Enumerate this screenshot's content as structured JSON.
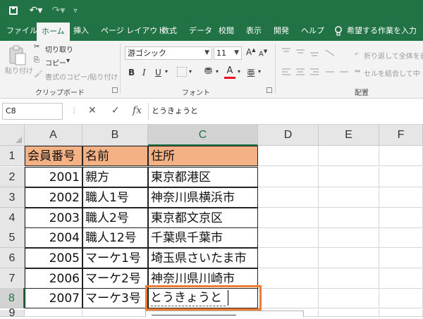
{
  "qat": {
    "customize_glyph": "▿"
  },
  "tabs": [
    "ファイル",
    "ホーム",
    "挿入",
    "ページ レイアウト",
    "数式",
    "データ",
    "校閲",
    "表示",
    "開発",
    "ヘルプ"
  ],
  "tell_me": "希望する作業を入力",
  "ribbon": {
    "clipboard": {
      "paste": "貼り付け",
      "cut": "切り取り",
      "copy": "コピー",
      "copy_caret": "▾",
      "format_painter": "書式のコピー/貼り付け",
      "label": "クリップボード"
    },
    "font": {
      "name": "游ゴシック",
      "size": "11",
      "grow": "A",
      "shrink": "A",
      "bold": "B",
      "italic": "I",
      "underline": "U",
      "underline_caret": "▾",
      "border_caret": "▾",
      "fill_caret": "▾",
      "color_letter": "A",
      "color_caret": "▾",
      "phonetic": "亜",
      "phonetic_caret": "▾",
      "label": "フォント"
    },
    "alignment": {
      "wrap": "折り返して全体を表",
      "merge": "セルを結合して中",
      "label": "配置"
    }
  },
  "formula_bar": {
    "name_box": "C8",
    "formula": "とうきょうと",
    "cancel": "✕",
    "enter": "✓",
    "fx": "fx"
  },
  "columns": [
    "A",
    "B",
    "C",
    "D",
    "E",
    "F"
  ],
  "rows": [
    {
      "n": "1",
      "a": "会員番号",
      "b": "名前",
      "c": "住所"
    },
    {
      "n": "2",
      "a": "2001",
      "b": "親方",
      "c": "東京都港区"
    },
    {
      "n": "3",
      "a": "2002",
      "b": "職人1号",
      "c": "神奈川県横浜市"
    },
    {
      "n": "4",
      "a": "2003",
      "b": "職人2号",
      "c": "東京都文京区"
    },
    {
      "n": "5",
      "a": "2004",
      "b": "職人12号",
      "c": "千葉県千葉市"
    },
    {
      "n": "6",
      "a": "2005",
      "b": "マーケ1号",
      "c": "埼玉県さいたま市"
    },
    {
      "n": "7",
      "a": "2006",
      "b": "マーケ2号",
      "c": "神奈川県川崎市"
    },
    {
      "n": "8",
      "a": "2007",
      "b": "マーケ3号",
      "c": "とうきょうと"
    },
    {
      "n": "9"
    }
  ],
  "colors": {
    "excel_green": "#217346",
    "header_fill": "#f4b183",
    "highlight": "#ed7d31",
    "font_red": "#e81123"
  }
}
